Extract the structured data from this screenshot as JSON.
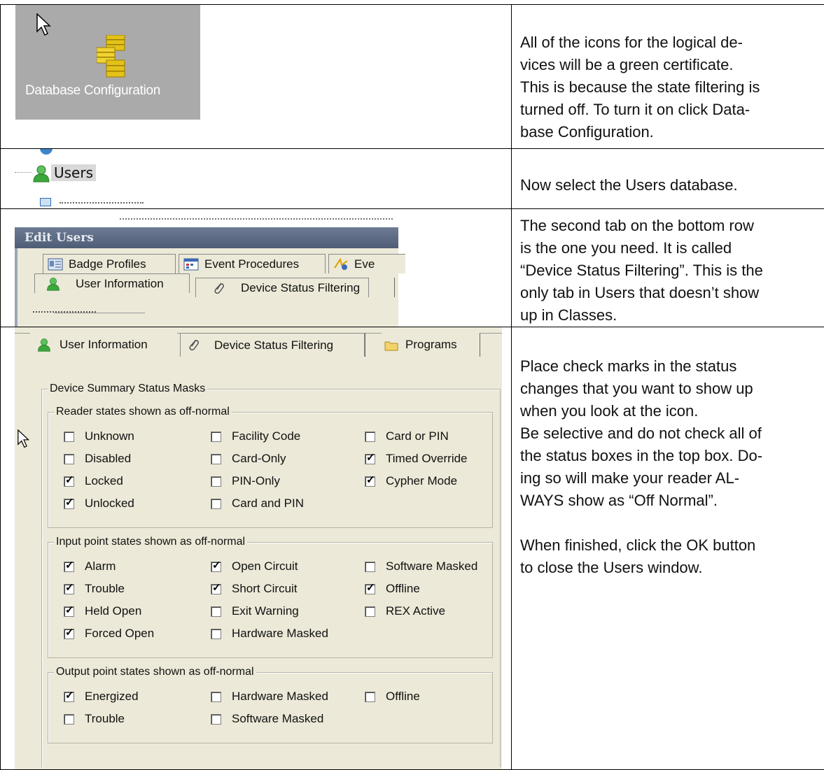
{
  "rows": [
    {
      "description": "All of the icons for the logical de-\nvices will be a green certificate.\nThis is because the state filtering is\nturned off. To turn it on click Data-\nbase Configuration.",
      "screenshot": {
        "tile_label": "Database Configuration"
      }
    },
    {
      "description": "Now select the Users database.",
      "screenshot": {
        "item_label": "Users"
      }
    },
    {
      "description": "The second tab on the bottom row\nis the one you need. It is called\n“Device Status Filtering”. This is the\nonly tab in Users that doesn’t show\nup in Classes.",
      "screenshot": {
        "window_title": "Edit Users",
        "tabs_top": [
          "Badge Profiles",
          "Event Procedures",
          "Eve"
        ],
        "tabs_bottom": [
          "User Information",
          "Device Status Filtering"
        ]
      }
    },
    {
      "description": "Place check marks in the status\nchanges that you want to show up\nwhen you look at the icon.\nBe selective and do not check all of\nthe status boxes in the top box. Do-\ning so will make your reader AL-\nWAYS show as “Off Normal”.\n\nWhen finished, click the OK button\nto close the Users window.",
      "screenshot": {
        "tabs": [
          "User Information",
          "Device Status Filtering",
          "Programs"
        ],
        "outer_group": "Device Summary Status Masks",
        "groups": [
          {
            "title": "Reader states shown as off-normal",
            "columns": [
              [
                {
                  "label": "Unknown",
                  "checked": false
                },
                {
                  "label": "Disabled",
                  "checked": false
                },
                {
                  "label": "Locked",
                  "checked": true
                },
                {
                  "label": "Unlocked",
                  "checked": true
                }
              ],
              [
                {
                  "label": "Facility Code",
                  "checked": false
                },
                {
                  "label": "Card-Only",
                  "checked": false
                },
                {
                  "label": "PIN-Only",
                  "checked": false
                },
                {
                  "label": "Card and PIN",
                  "checked": false
                }
              ],
              [
                {
                  "label": "Card or PIN",
                  "checked": false
                },
                {
                  "label": "Timed Override",
                  "checked": true
                },
                {
                  "label": "Cypher Mode",
                  "checked": true
                }
              ]
            ]
          },
          {
            "title": "Input point states shown as off-normal",
            "columns": [
              [
                {
                  "label": "Alarm",
                  "checked": true
                },
                {
                  "label": "Trouble",
                  "checked": true
                },
                {
                  "label": "Held Open",
                  "checked": true
                },
                {
                  "label": "Forced Open",
                  "checked": true
                }
              ],
              [
                {
                  "label": "Open Circuit",
                  "checked": true
                },
                {
                  "label": "Short Circuit",
                  "checked": true
                },
                {
                  "label": "Exit Warning",
                  "checked": false
                },
                {
                  "label": "Hardware Masked",
                  "checked": false
                }
              ],
              [
                {
                  "label": "Software Masked",
                  "checked": false
                },
                {
                  "label": "Offline",
                  "checked": true
                },
                {
                  "label": "REX Active",
                  "checked": false
                }
              ]
            ]
          },
          {
            "title": "Output point states shown as off-normal",
            "columns": [
              [
                {
                  "label": "Energized",
                  "checked": true
                },
                {
                  "label": "Trouble",
                  "checked": false
                }
              ],
              [
                {
                  "label": "Hardware Masked",
                  "checked": false
                },
                {
                  "label": "Software Masked",
                  "checked": false
                }
              ],
              [
                {
                  "label": "Offline",
                  "checked": false
                }
              ]
            ]
          }
        ]
      }
    }
  ],
  "icons": {
    "cursor": "mouse-pointer-icon",
    "database": "database-stack-icon",
    "user": "user-icon",
    "badge": "badge-profiles-icon",
    "event": "event-procedures-icon",
    "filter": "paperclip-icon",
    "folder": "folder-icon"
  },
  "colors": {
    "tile_bg": "#aaaaaa",
    "dialog_bg": "#ece9d8",
    "caption_bg": "#5a6880",
    "user_green": "#3aa83a",
    "db_gold": "#e3c21a"
  }
}
